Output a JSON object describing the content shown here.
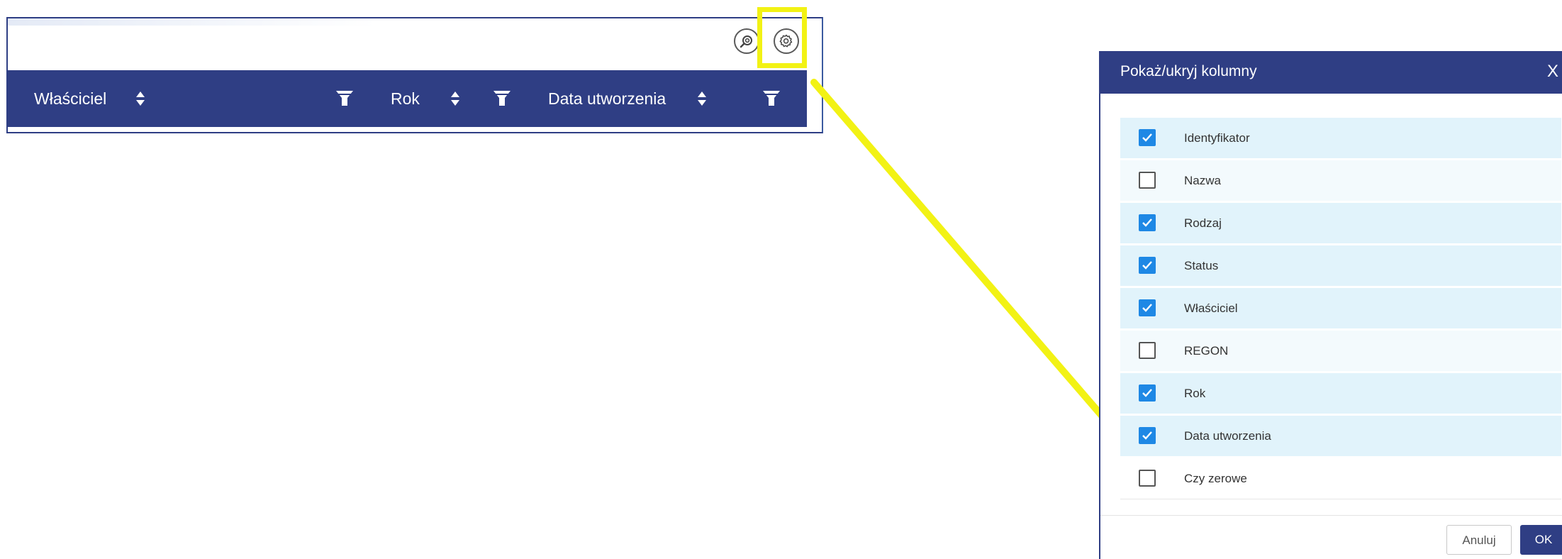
{
  "table": {
    "columns": [
      {
        "label": "Właściciel",
        "sortable": true,
        "filterable": true
      },
      {
        "label": "Rok",
        "sortable": true,
        "filterable": true
      },
      {
        "label": "Data utworzenia",
        "sortable": true,
        "filterable": true
      }
    ],
    "toolbar": {
      "search_icon": "search-icon",
      "settings_icon": "gear-icon"
    }
  },
  "dialog": {
    "title": "Pokaż/ukryj kolumny",
    "close_glyph": "X",
    "items": [
      {
        "label": "Identyfikator",
        "checked": true
      },
      {
        "label": "Nazwa",
        "checked": false
      },
      {
        "label": "Rodzaj",
        "checked": true
      },
      {
        "label": "Status",
        "checked": true
      },
      {
        "label": "Właściciel",
        "checked": true
      },
      {
        "label": "REGON",
        "checked": false
      },
      {
        "label": "Rok",
        "checked": true
      },
      {
        "label": "Data utworzenia",
        "checked": true
      },
      {
        "label": "Czy zerowe",
        "checked": false
      }
    ],
    "cancel_label": "Anuluj",
    "ok_label": "OK"
  },
  "colors": {
    "header_bg": "#2f3e84",
    "highlight": "#f2f214",
    "checkbox_on": "#1e88e5",
    "row_checked_bg": "#e1f3fb"
  }
}
